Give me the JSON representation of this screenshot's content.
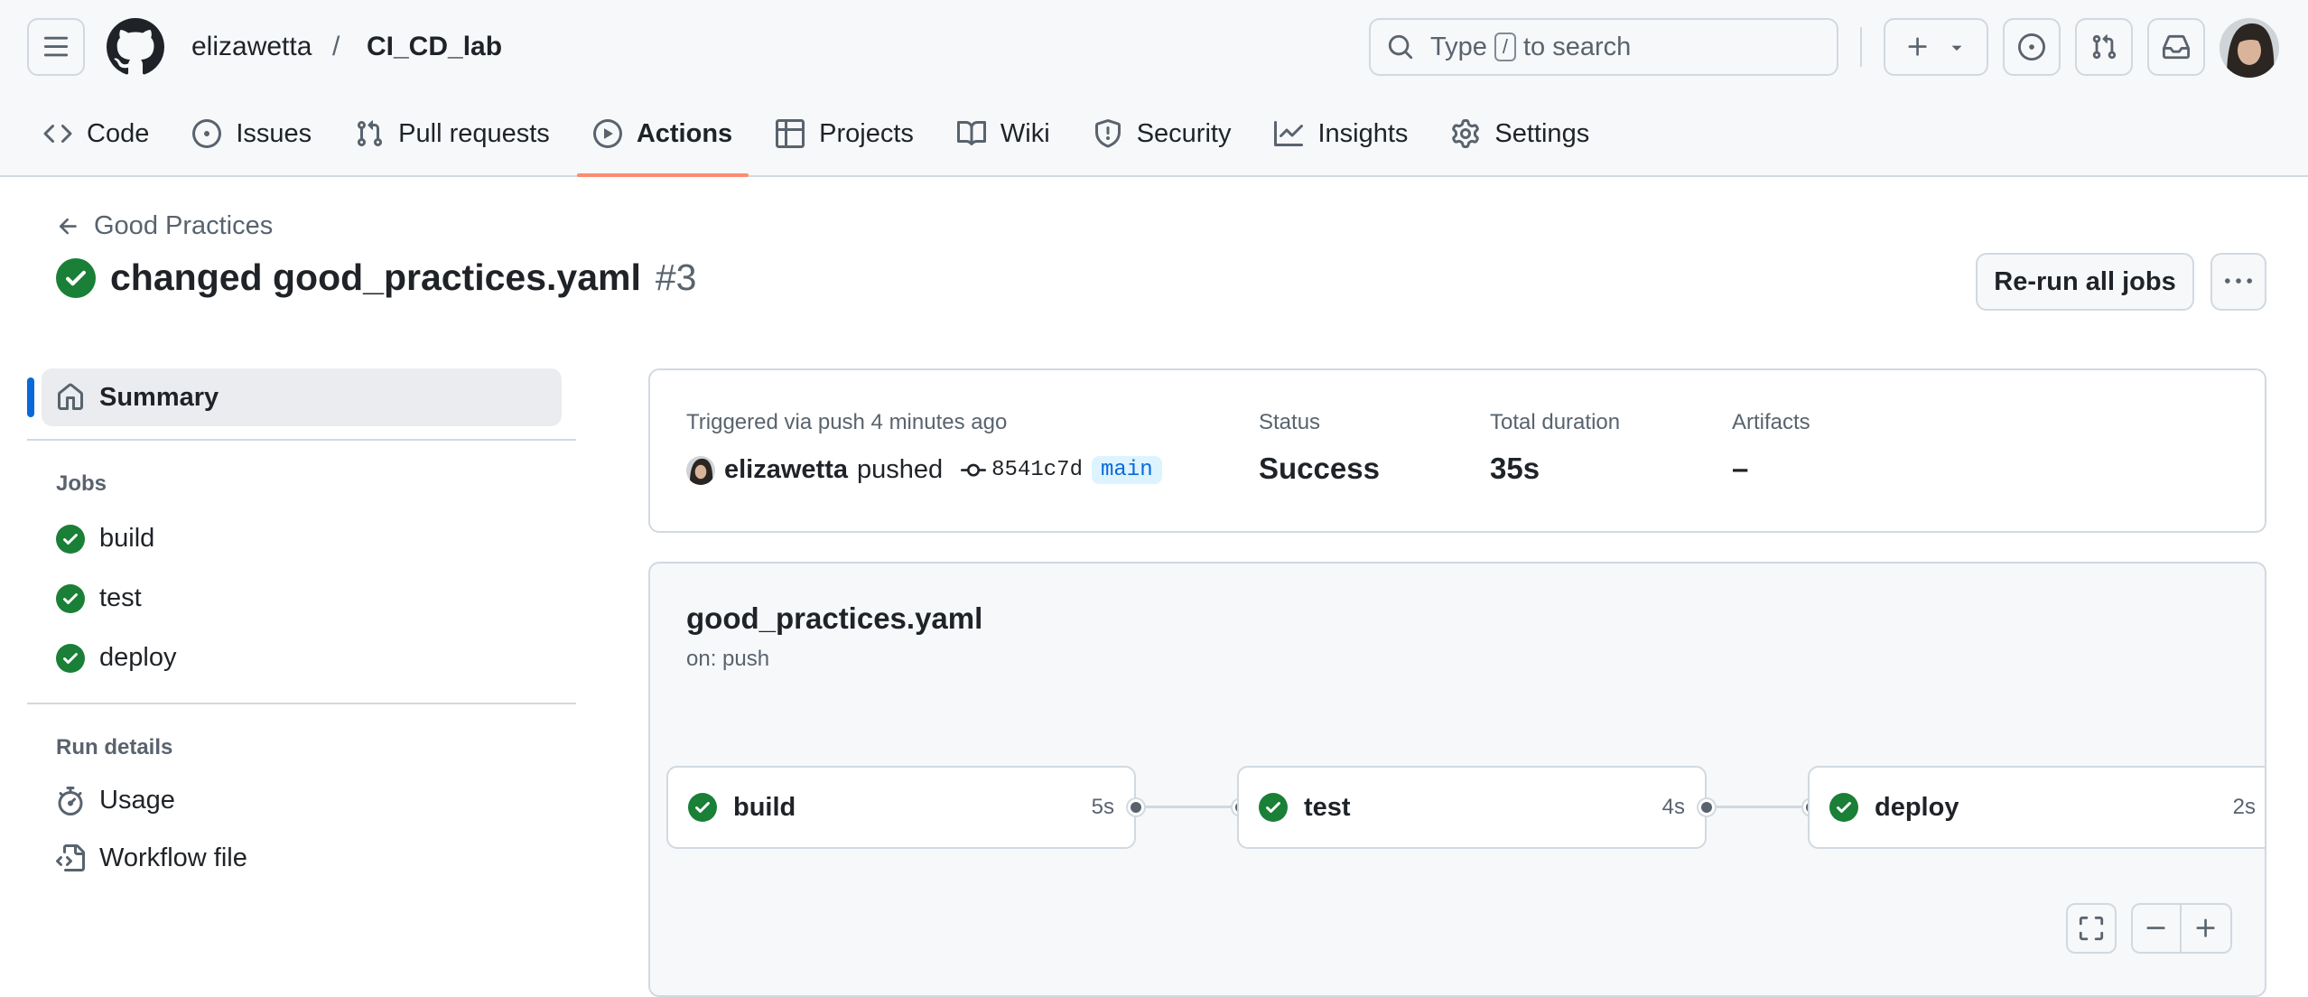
{
  "header": {
    "owner": "elizawetta",
    "separator": "/",
    "repo": "CI_CD_lab",
    "search": {
      "before": "Type",
      "key": "/",
      "after": "to search"
    }
  },
  "repo_nav": [
    {
      "label": "Code",
      "icon": "code-icon"
    },
    {
      "label": "Issues",
      "icon": "issue-opened-icon"
    },
    {
      "label": "Pull requests",
      "icon": "git-pull-request-icon"
    },
    {
      "label": "Actions",
      "icon": "play-icon",
      "active": true
    },
    {
      "label": "Projects",
      "icon": "table-icon"
    },
    {
      "label": "Wiki",
      "icon": "book-icon"
    },
    {
      "label": "Security",
      "icon": "shield-icon"
    },
    {
      "label": "Insights",
      "icon": "graph-icon"
    },
    {
      "label": "Settings",
      "icon": "gear-icon"
    }
  ],
  "run": {
    "back_label": "Good Practices",
    "title": "changed good_practices.yaml",
    "number": "#3",
    "rerun_label": "Re-run all jobs"
  },
  "sidebar": {
    "summary_label": "Summary",
    "jobs_heading": "Jobs",
    "jobs": [
      "build",
      "test",
      "deploy"
    ],
    "details_heading": "Run details",
    "details": [
      {
        "label": "Usage",
        "icon": "stopwatch-icon"
      },
      {
        "label": "Workflow file",
        "icon": "file-code-icon"
      }
    ]
  },
  "summary": {
    "triggered": "Triggered via push 4 minutes ago",
    "actor": "elizawetta",
    "action": "pushed",
    "sha": "8541c7d",
    "branch": "main",
    "status_label": "Status",
    "status_value": "Success",
    "duration_label": "Total duration",
    "duration_value": "35s",
    "artifacts_label": "Artifacts",
    "artifacts_value": "–"
  },
  "workflow": {
    "file": "good_practices.yaml",
    "trigger": "on: push",
    "jobs": [
      {
        "name": "build",
        "duration": "5s"
      },
      {
        "name": "test",
        "duration": "4s"
      },
      {
        "name": "deploy",
        "duration": "2s"
      }
    ]
  },
  "colors": {
    "accent": "#0969da",
    "success": "#1a7f37",
    "tab_underline": "#fd8c73"
  }
}
